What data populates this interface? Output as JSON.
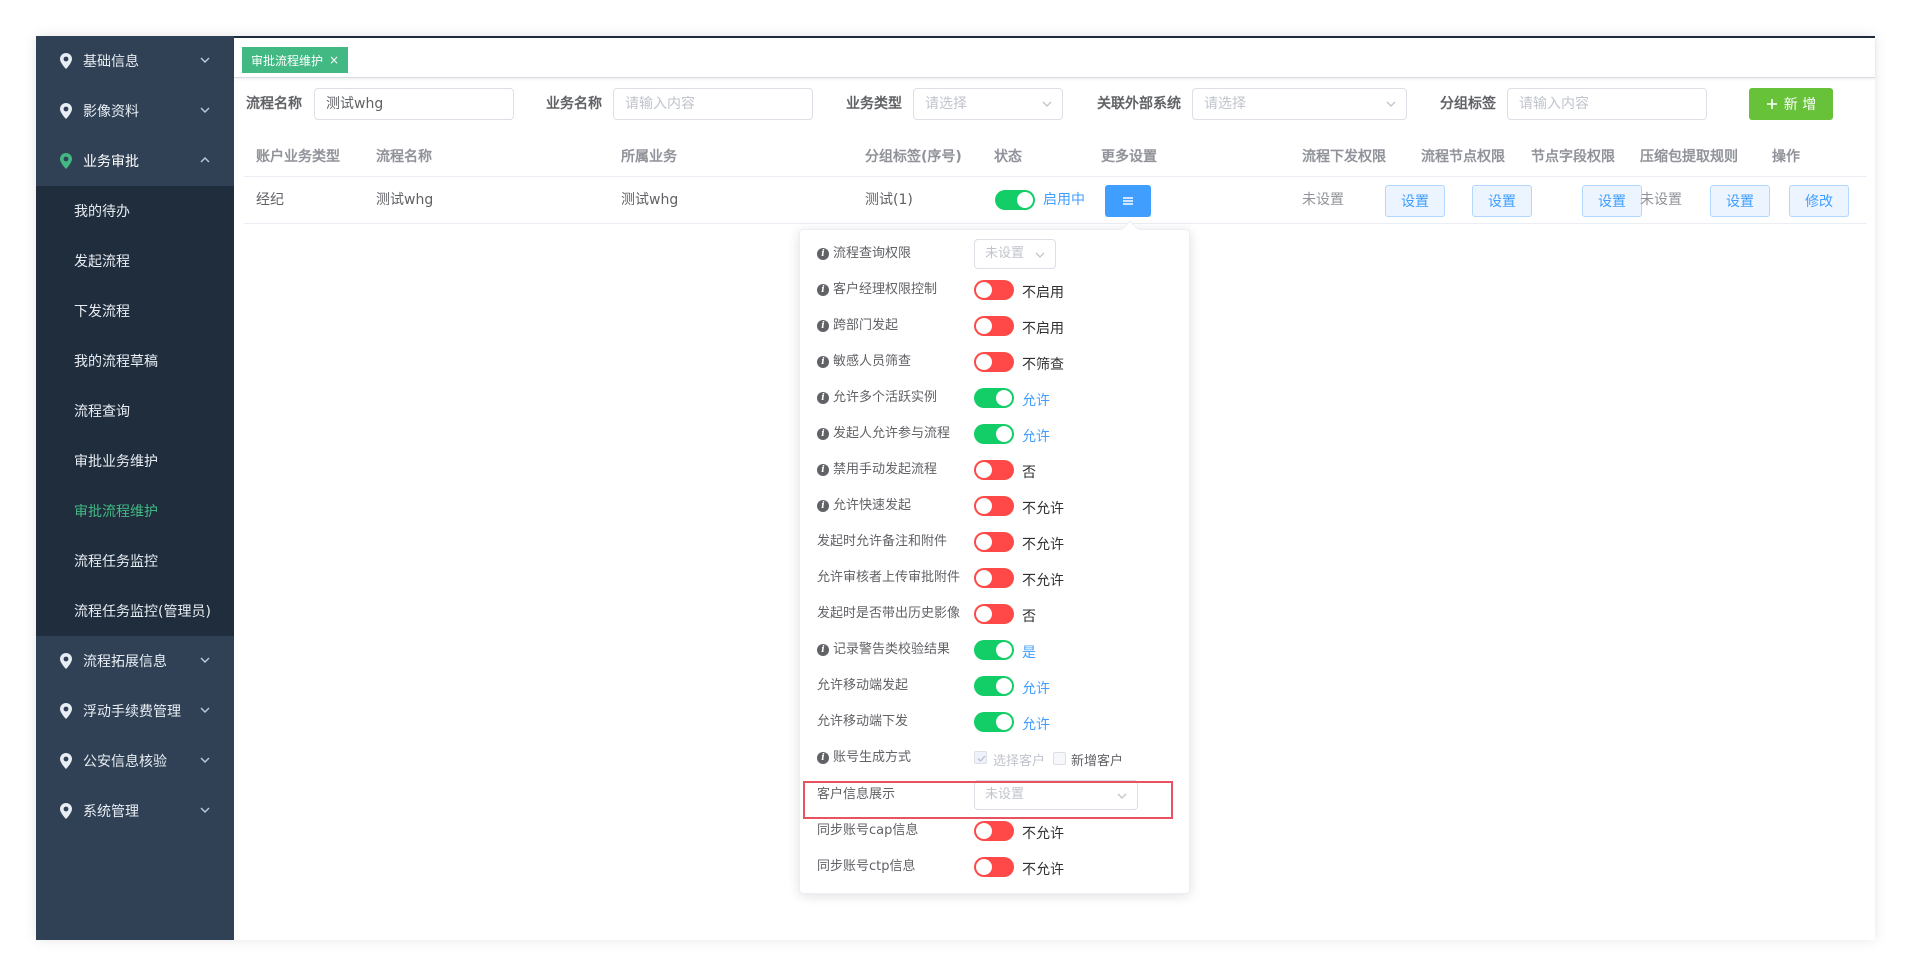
{
  "sidebar": {
    "groups_top": [
      {
        "label": "基础信息"
      },
      {
        "label": "影像资料"
      },
      {
        "label": "业务审批"
      }
    ],
    "sub_items": [
      {
        "label": "我的待办"
      },
      {
        "label": "发起流程"
      },
      {
        "label": "下发流程"
      },
      {
        "label": "我的流程草稿"
      },
      {
        "label": "流程查询"
      },
      {
        "label": "审批业务维护"
      },
      {
        "label": "审批流程维护"
      },
      {
        "label": "流程任务监控"
      },
      {
        "label": "流程任务监控(管理员)"
      }
    ],
    "groups_bottom": [
      {
        "label": "流程拓展信息"
      },
      {
        "label": "浮动手续费管理"
      },
      {
        "label": "公安信息核验"
      },
      {
        "label": "系统管理"
      }
    ]
  },
  "tab": {
    "label": "审批流程维护",
    "close": "×"
  },
  "filters": {
    "flow_name_label": "流程名称",
    "flow_name_value": "测试whg",
    "biz_name_label": "业务名称",
    "biz_name_placeholder": "请输入内容",
    "biz_type_label": "业务类型",
    "biz_type_placeholder": "请选择",
    "ext_sys_label": "关联外部系统",
    "ext_sys_placeholder": "请选择",
    "group_tag_label": "分组标签",
    "group_tag_placeholder": "请输入内容",
    "add_label": "新 增"
  },
  "table": {
    "headers": [
      "账户业务类型",
      "流程名称",
      "所属业务",
      "分组标签(序号)",
      "状态",
      "更多设置",
      "流程下发权限",
      "流程节点权限",
      "节点字段权限",
      "压缩包提取规则",
      "操作"
    ],
    "row": {
      "acct_type": "经纪",
      "flow_name": "测试whg",
      "biz": "测试whg",
      "group_tag": "测试(1)",
      "status": "启用中",
      "dispatch_unset": "未设置",
      "set": "设置",
      "zip_unset": "未设置",
      "edit": "修改"
    }
  },
  "popover": {
    "rows": [
      {
        "label": "流程查询权限",
        "info": true,
        "type": "select",
        "value": "未设置"
      },
      {
        "label": "客户经理权限控制",
        "info": true,
        "type": "switch",
        "on": false,
        "text": "不启用"
      },
      {
        "label": "跨部门发起",
        "info": true,
        "type": "switch",
        "on": false,
        "text": "不启用"
      },
      {
        "label": "敏感人员筛查",
        "info": true,
        "type": "switch",
        "on": false,
        "text": "不筛查"
      },
      {
        "label": "允许多个活跃实例",
        "info": true,
        "type": "switch",
        "on": true,
        "text": "允许"
      },
      {
        "label": "发起人允许参与流程",
        "info": true,
        "type": "switch",
        "on": true,
        "text": "允许"
      },
      {
        "label": "禁用手动发起流程",
        "info": true,
        "type": "switch",
        "on": false,
        "text": "否"
      },
      {
        "label": "允许快速发起",
        "info": true,
        "type": "switch",
        "on": false,
        "text": "不允许"
      },
      {
        "label": "发起时允许备注和附件",
        "info": false,
        "type": "switch",
        "on": false,
        "text": "不允许"
      },
      {
        "label": "允许审核者上传审批附件",
        "info": false,
        "type": "switch",
        "on": false,
        "text": "不允许"
      },
      {
        "label": "发起时是否带出历史影像",
        "info": false,
        "type": "switch",
        "on": false,
        "text": "否"
      },
      {
        "label": "记录警告类校验结果",
        "info": true,
        "type": "switch",
        "on": true,
        "text": "是"
      },
      {
        "label": "允许移动端发起",
        "info": false,
        "type": "switch",
        "on": true,
        "text": "允许"
      },
      {
        "label": "允许移动端下发",
        "info": false,
        "type": "switch",
        "on": true,
        "text": "允许"
      },
      {
        "label": "账号生成方式",
        "info": true,
        "type": "checkbox",
        "options": [
          "选择客户",
          "新增客户"
        ]
      },
      {
        "label": "客户信息展示",
        "info": false,
        "type": "select",
        "value": "未设置"
      },
      {
        "label": "同步账号cap信息",
        "info": false,
        "type": "switch",
        "on": false,
        "text": "不允许"
      },
      {
        "label": "同步账号ctp信息",
        "info": false,
        "type": "switch",
        "on": false,
        "text": "不允许"
      }
    ]
  },
  "colors": {
    "sidebar_bg": "#304156",
    "submenu_bg": "#1f2d3d",
    "accent": "#42b983",
    "primary": "#409eff",
    "success": "#13ce66",
    "danger": "#ff4949",
    "add_btn": "#67c23a",
    "highlight_box": "#e8535f"
  }
}
